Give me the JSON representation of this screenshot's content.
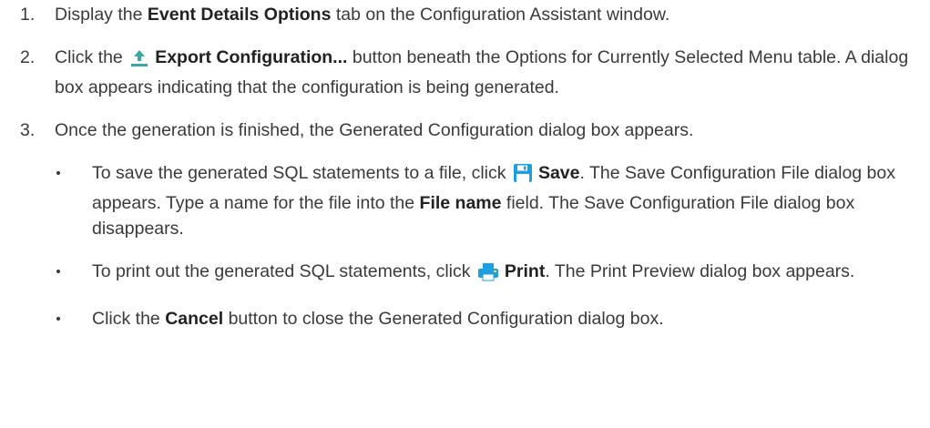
{
  "steps": [
    {
      "number": "1.",
      "pre": "Display the ",
      "bold": "Event Details Options",
      "post": " tab on the Configuration Assistant window."
    },
    {
      "number": "2.",
      "pre": "Click the ",
      "icon": "upload-arrow-icon",
      "bold": "Export Configuration...",
      "post": " button beneath the Options for Currently Selected Menu table. A dialog box appears indicating that the configuration is being generated."
    },
    {
      "number": "3.",
      "text": "Once the generation is finished, the Generated Configuration dialog box appears."
    }
  ],
  "bullets": [
    {
      "pre": "To save the generated SQL statements to a file, click ",
      "icon": "floppy-save-icon",
      "bold": "Save",
      "mid": ". The Save Configuration File dialog box appears. Type a name for the file into the ",
      "bold2": "File name",
      "post": " field. The Save Configuration File dialog box disappears."
    },
    {
      "pre": "To print out the generated SQL statements, click ",
      "icon": "printer-icon",
      "bold": "Print",
      "post": ". The Print Preview dialog box appears."
    },
    {
      "pre": "Click the ",
      "bold": "Cancel",
      "post": " button to close the Generated Configuration dialog box."
    }
  ],
  "colors": {
    "text": "#3a3a3a",
    "upload_icon": "#3aa7a0",
    "save_icon": "#1e9fe0",
    "print_icon": "#1e9fe0"
  }
}
